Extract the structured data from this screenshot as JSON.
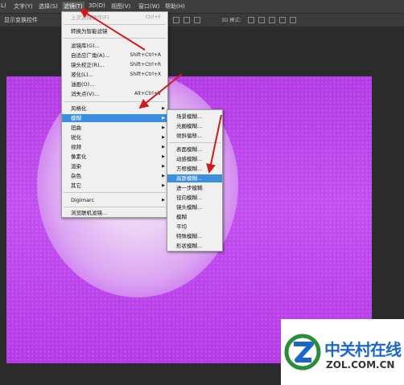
{
  "menubar": {
    "items": [
      {
        "label": "L)"
      },
      {
        "label": "文字(Y)"
      },
      {
        "label": "选择(S)"
      },
      {
        "label": "滤镜(T)"
      },
      {
        "label": "3D(D)"
      },
      {
        "label": "视图(V)"
      },
      {
        "label": "窗口(W)"
      },
      {
        "label": "帮助(H)"
      }
    ]
  },
  "options": {
    "show_transform": "显示变换控件",
    "mode_3d": "3D 模式："
  },
  "filter_menu": {
    "items": [
      {
        "label": "上次滤镜操作(F)",
        "shortcut": "Ctrl+F",
        "disabled": true
      },
      {
        "label": "转换为智能滤镜"
      },
      {
        "label": "滤镜库(G)..."
      },
      {
        "label": "自适应广角(A)...",
        "shortcut": "Shift+Ctrl+A"
      },
      {
        "label": "镜头校正(R)...",
        "shortcut": "Shift+Ctrl+R"
      },
      {
        "label": "液化(L)...",
        "shortcut": "Shift+Ctrl+X"
      },
      {
        "label": "油画(O)..."
      },
      {
        "label": "消失点(V)...",
        "shortcut": "Alt+Ctrl+V"
      },
      {
        "label": "风格化"
      },
      {
        "label": "模糊"
      },
      {
        "label": "扭曲"
      },
      {
        "label": "锐化"
      },
      {
        "label": "视频"
      },
      {
        "label": "像素化"
      },
      {
        "label": "渲染"
      },
      {
        "label": "杂色"
      },
      {
        "label": "其它"
      },
      {
        "label": "Digimarc"
      },
      {
        "label": "浏览联机滤镜..."
      }
    ]
  },
  "blur_submenu": {
    "items": [
      {
        "label": "场景模糊..."
      },
      {
        "label": "光圈模糊..."
      },
      {
        "label": "倾斜偏移..."
      },
      {
        "label": "表面模糊..."
      },
      {
        "label": "动感模糊..."
      },
      {
        "label": "方框模糊..."
      },
      {
        "label": "高斯模糊..."
      },
      {
        "label": "进一步模糊"
      },
      {
        "label": "径向模糊..."
      },
      {
        "label": "镜头模糊..."
      },
      {
        "label": "模糊"
      },
      {
        "label": "平均"
      },
      {
        "label": "特殊模糊..."
      },
      {
        "label": "形状模糊..."
      }
    ]
  },
  "watermark": {
    "cn": "中关村在线",
    "en": "ZOL.COM.CN"
  },
  "colors": {
    "highlight": "#3b8fe0",
    "arrow": "#d11a1a",
    "brand_blue": "#1b66c9"
  }
}
